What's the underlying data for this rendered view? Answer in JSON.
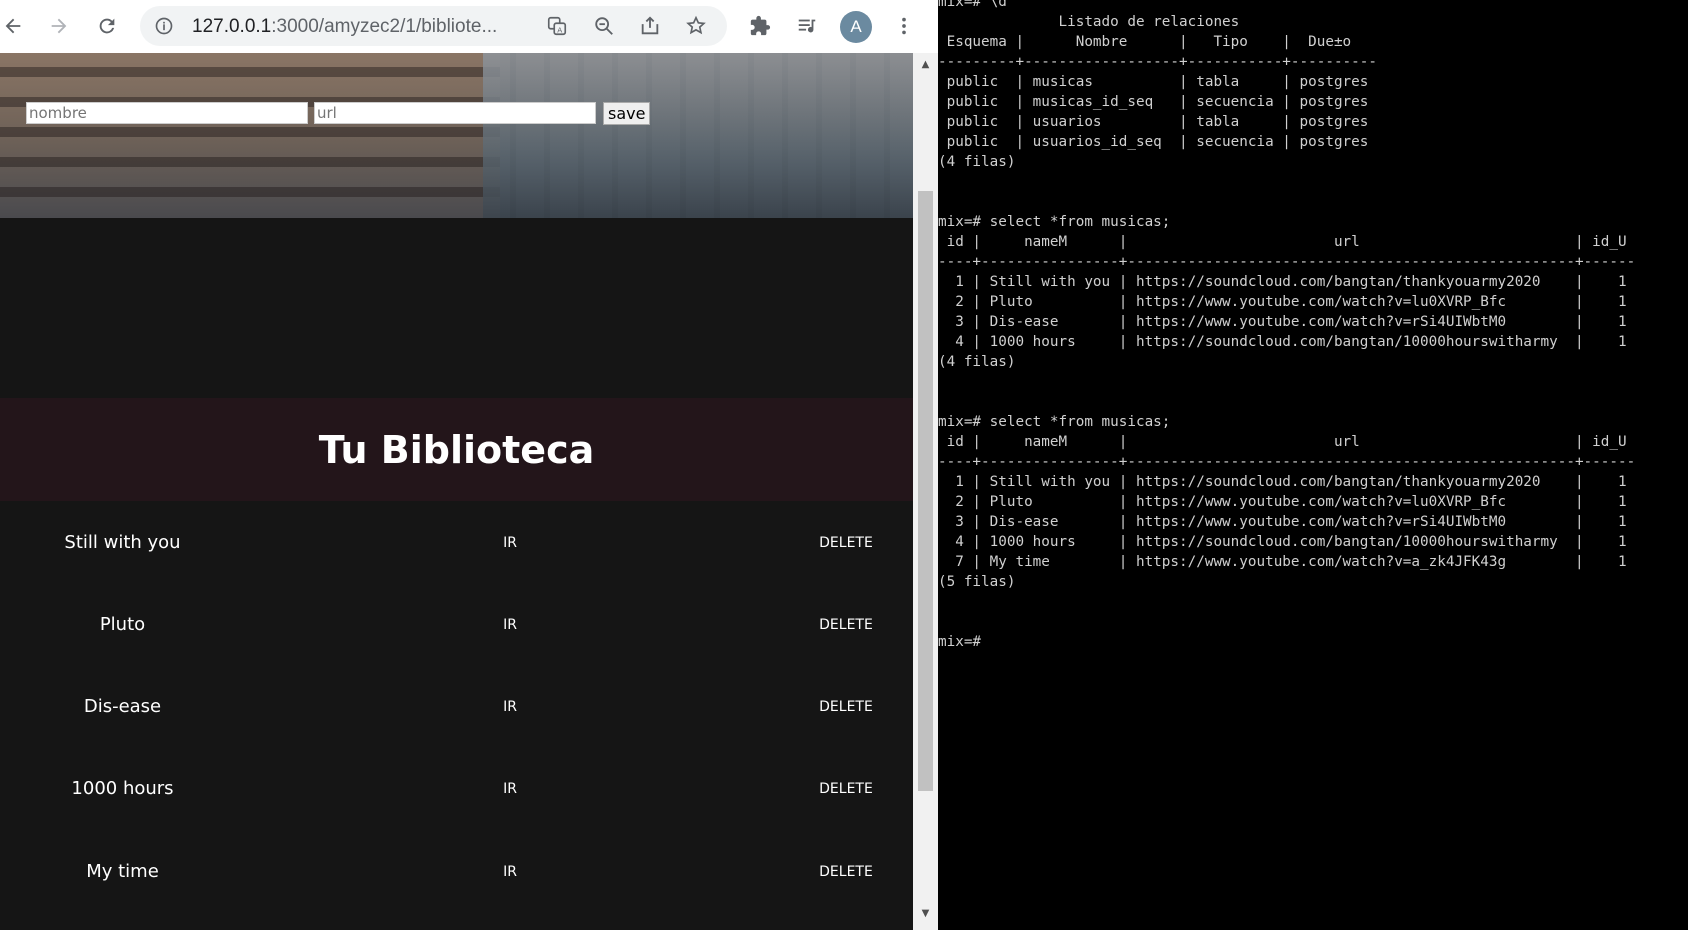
{
  "browser": {
    "url_host": "127.0.0.1",
    "url_rest": ":3000/amyzec2/1/bibliote...",
    "avatar_letter": "A",
    "icons": [
      "back-icon",
      "forward-icon",
      "reload-icon",
      "info-icon",
      "translate-icon",
      "zoom-out-icon",
      "share-icon",
      "bookmark-star-icon",
      "extensions-icon",
      "media-queue-icon",
      "kebab-menu-icon"
    ]
  },
  "form": {
    "name_placeholder": "nombre",
    "url_placeholder": "url",
    "save_label": "save"
  },
  "library": {
    "title": "Tu Biblioteca",
    "ir_label": "IR",
    "delete_label": "DELETE",
    "songs": [
      "Still with you",
      "Pluto",
      "Dis-ease",
      "1000 hours",
      "My time"
    ]
  },
  "terminal": {
    "text": "mix=# \\d\n              Listado de relaciones\n Esquema |      Nombre      |   Tipo    |  Due±o\n---------+------------------+-----------+----------\n public  | musicas          | tabla     | postgres\n public  | musicas_id_seq   | secuencia | postgres\n public  | usuarios         | tabla     | postgres\n public  | usuarios_id_seq  | secuencia | postgres\n(4 filas)\n\n\nmix=# select *from musicas;\n id |     nameM      |                        url                         | id_U\n----+----------------+----------------------------------------------------+------\n  1 | Still with you | https://soundcloud.com/bangtan/thankyouarmy2020    |    1\n  2 | Pluto          | https://www.youtube.com/watch?v=lu0XVRP_Bfc        |    1\n  3 | Dis-ease       | https://www.youtube.com/watch?v=rSi4UIWbtM0        |    1\n  4 | 1000 hours     | https://soundcloud.com/bangtan/10000hourswitharmy  |    1\n(4 filas)\n\n\nmix=# select *from musicas;\n id |     nameM      |                        url                         | id_U\n----+----------------+----------------------------------------------------+------\n  1 | Still with you | https://soundcloud.com/bangtan/thankyouarmy2020    |    1\n  2 | Pluto          | https://www.youtube.com/watch?v=lu0XVRP_Bfc        |    1\n  3 | Dis-ease       | https://www.youtube.com/watch?v=rSi4UIWbtM0        |    1\n  4 | 1000 hours     | https://soundcloud.com/bangtan/10000hourswitharmy  |    1\n  7 | My time        | https://www.youtube.com/watch?v=a_zk4JFK43g        |    1\n(5 filas)\n\n\nmix=#"
  }
}
